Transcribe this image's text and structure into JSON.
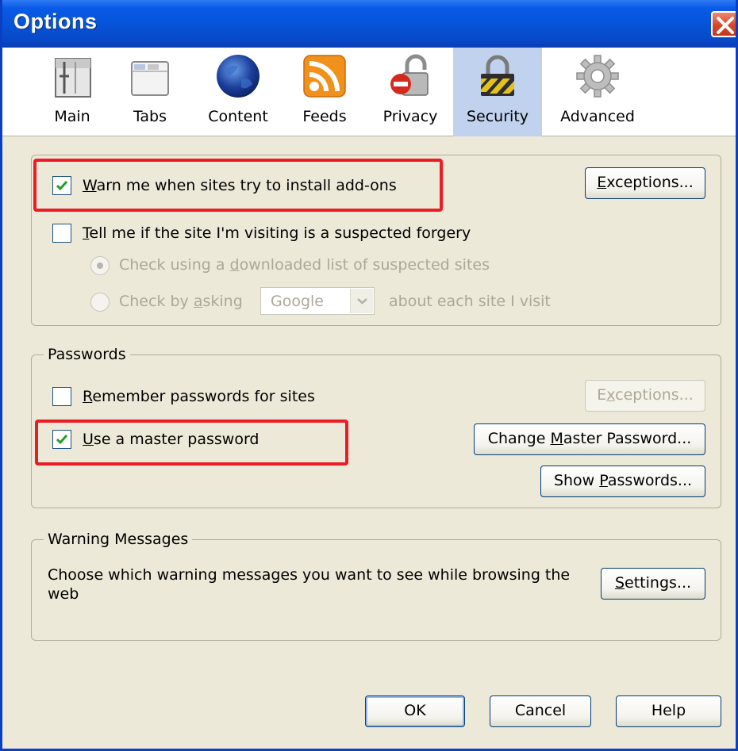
{
  "window": {
    "title": "Options"
  },
  "toolbar": {
    "items": [
      {
        "label": "Main",
        "icon": "main-window-icon"
      },
      {
        "label": "Tabs",
        "icon": "tabs-icon"
      },
      {
        "label": "Content",
        "icon": "globe-icon"
      },
      {
        "label": "Feeds",
        "icon": "rss-feed-icon"
      },
      {
        "label": "Privacy",
        "icon": "privacy-lock-icon"
      },
      {
        "label": "Security",
        "icon": "padlock-icon",
        "selected": true
      },
      {
        "label": "Advanced",
        "icon": "gear-icon"
      }
    ]
  },
  "security": {
    "warn_addons_pre": "",
    "warn_addons_access": "W",
    "warn_addons_rest": "arn me when sites try to install add-ons",
    "warn_addons_checked": true,
    "exceptions_pre": "",
    "exceptions_access": "E",
    "exceptions_rest": "xceptions...",
    "forgery_access": "T",
    "forgery_rest": "ell me if the site I'm visiting is a suspected forgery",
    "forgery_checked": false,
    "check_list_pre": "Check using a ",
    "check_list_access": "d",
    "check_list_rest": "ownloaded list of suspected sites",
    "check_ask_pre": "Check by ",
    "check_ask_access": "a",
    "check_ask_rest": "sking",
    "provider_value": "Google",
    "check_ask_suffix": "about each site I visit"
  },
  "passwords": {
    "caption": "Passwords",
    "remember_access": "R",
    "remember_rest": "emember passwords for sites",
    "remember_checked": false,
    "exceptions_pre": "E",
    "exceptions_access": "x",
    "exceptions_rest": "ceptions...",
    "master_access": "U",
    "master_rest": "se a master password",
    "master_checked": true,
    "change_pre": "Change ",
    "change_access": "M",
    "change_rest": "aster Password...",
    "show_pre": "Show ",
    "show_access": "P",
    "show_rest": "asswords..."
  },
  "warnings": {
    "caption": "Warning Messages",
    "description_line1": "Choose which warning messages you want to see while browsing the",
    "description_line2": "web",
    "settings_access": "S",
    "settings_rest": "ettings..."
  },
  "footer": {
    "ok_label": "OK",
    "cancel_label": "Cancel",
    "help_label": "Help"
  },
  "colors": {
    "title_bar": "#0654d8",
    "dialog_bg": "#ece9d8",
    "selected_tab": "#c1d2ee",
    "highlight_box": "#ec1c24",
    "check_mark": "#21a121"
  }
}
